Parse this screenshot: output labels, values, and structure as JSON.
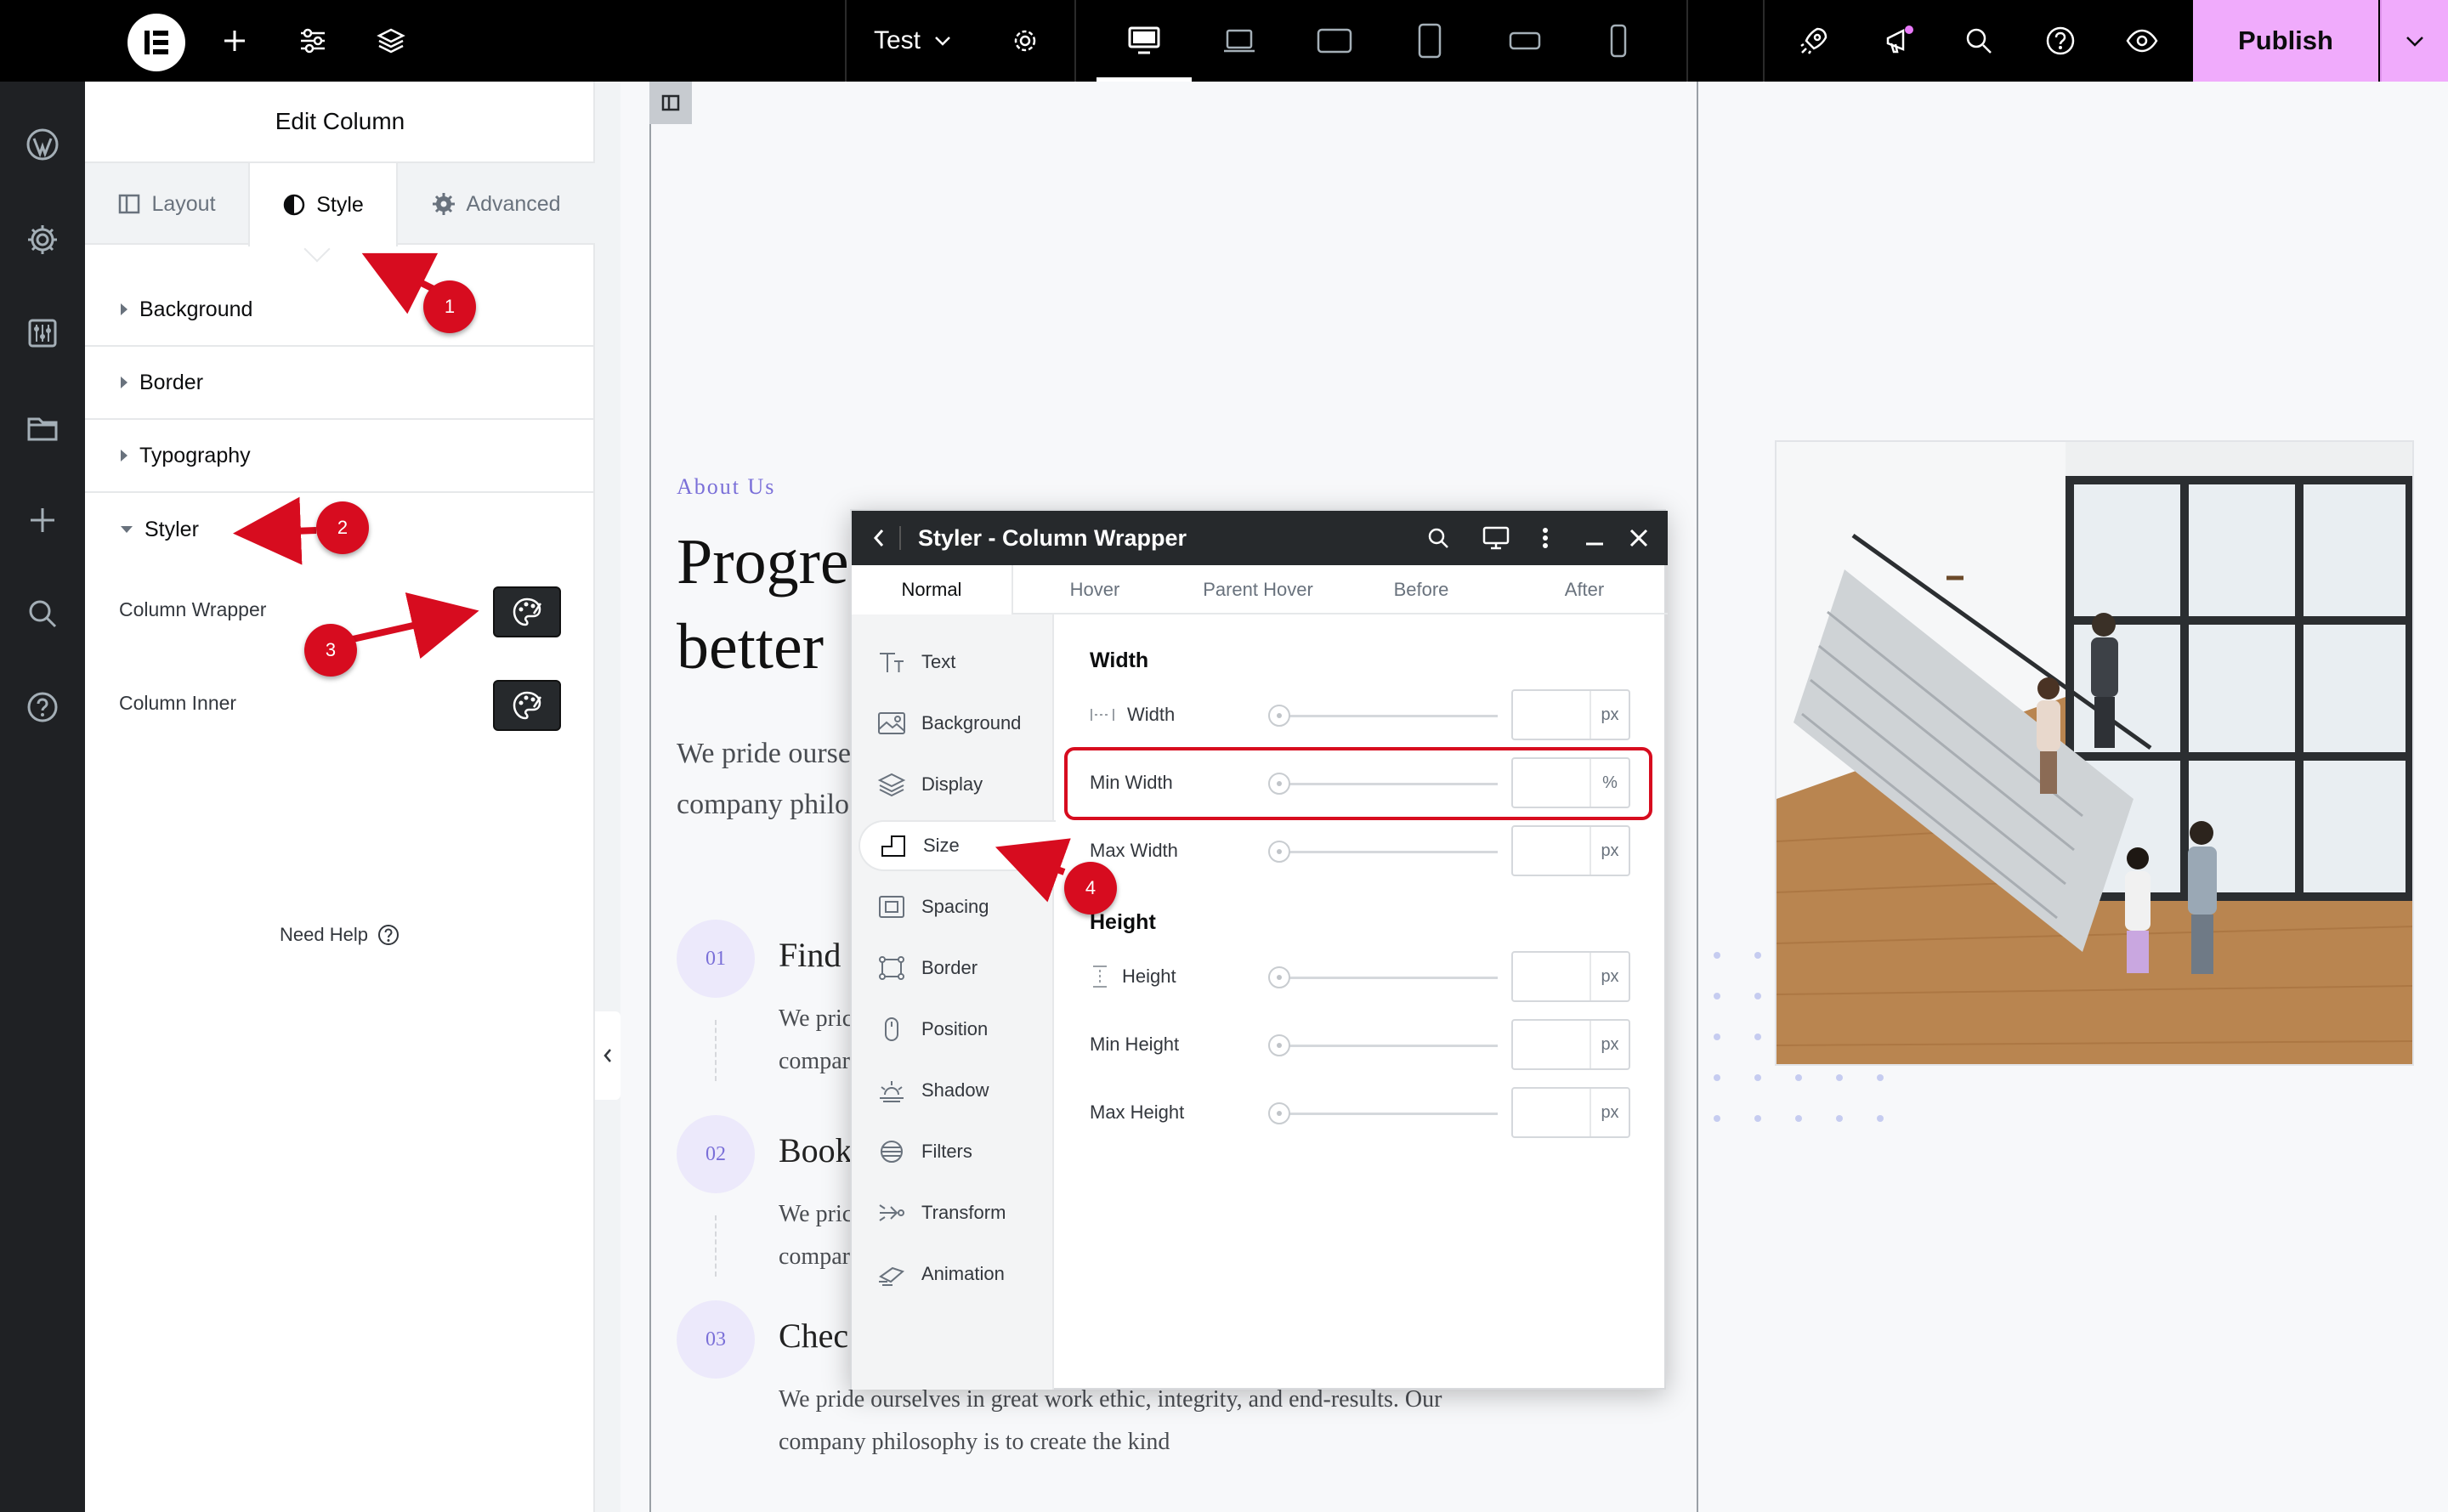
{
  "topbar": {
    "document_name": "Test",
    "publish_label": "Publish",
    "icons": [
      "add-element-icon",
      "site-settings-icon",
      "structure-layers-icon",
      "page-settings-gear-icon",
      "desktop-icon",
      "laptop-icon",
      "tablet-landscape-icon",
      "tablet-portrait-icon",
      "mobile-landscape-icon",
      "mobile-portrait-icon",
      "rocket-icon",
      "megaphone-icon",
      "search-icon",
      "help-icon",
      "preview-eye-icon",
      "chevron-down-icon"
    ],
    "notification_dot_color": "#e879f9",
    "publish_color": "#f0abfc"
  },
  "rail": {
    "icons": [
      "avatar",
      "wordpress-icon",
      "settings-gear-icon",
      "sliders-icon",
      "folder-icon",
      "add-icon",
      "search-icon",
      "help-icon"
    ]
  },
  "panel": {
    "title": "Edit Column",
    "tabs": [
      {
        "label": "Layout",
        "icon": "layout-icon"
      },
      {
        "label": "Style",
        "icon": "contrast-icon",
        "active": true
      },
      {
        "label": "Advanced",
        "icon": "gear-icon"
      }
    ],
    "sections": [
      {
        "label": "Background"
      },
      {
        "label": "Border"
      },
      {
        "label": "Typography"
      },
      {
        "label": "Styler",
        "open": true
      }
    ],
    "styler_rows": [
      {
        "label": "Column Wrapper",
        "icon": "palette-icon"
      },
      {
        "label": "Column Inner",
        "icon": "palette-icon"
      }
    ],
    "need_help": "Need Help"
  },
  "canvas": {
    "eyebrow": "About Us",
    "hero_line_1": "Progre",
    "hero_line_2": "better",
    "intro_line_1": "We pride ourse",
    "intro_line_2": "company philo",
    "steps": [
      {
        "num": "01",
        "title": "Find",
        "text_1": "We pric",
        "text_2": "compar"
      },
      {
        "num": "02",
        "title": "Book",
        "text_1": "We pric",
        "text_2": "compar"
      },
      {
        "num": "03",
        "title": "Chec",
        "text_1": "We pride ourselves in great work ethic, integrity, and end-results. Our",
        "text_2": "company philosophy is to create the kind"
      }
    ],
    "accent_color": "#7a6fd8"
  },
  "styler": {
    "title": "Styler - Column Wrapper",
    "tabs": [
      "Normal",
      "Hover",
      "Parent Hover",
      "Before",
      "After"
    ],
    "active_tab": "Normal",
    "side_items": [
      {
        "label": "Text",
        "icon": "text-icon"
      },
      {
        "label": "Background",
        "icon": "image-icon"
      },
      {
        "label": "Display",
        "icon": "layers-icon"
      },
      {
        "label": "Size",
        "icon": "size-icon",
        "active": true
      },
      {
        "label": "Spacing",
        "icon": "spacing-icon"
      },
      {
        "label": "Border",
        "icon": "border-icon"
      },
      {
        "label": "Position",
        "icon": "mouse-icon"
      },
      {
        "label": "Shadow",
        "icon": "sun-icon"
      },
      {
        "label": "Filters",
        "icon": "filters-icon"
      },
      {
        "label": "Transform",
        "icon": "transform-icon"
      },
      {
        "label": "Animation",
        "icon": "animation-icon"
      }
    ],
    "width_section": "Width",
    "height_section": "Height",
    "width_rows": [
      {
        "label": "Width",
        "unit": "px",
        "value": "",
        "icon": "width-icon"
      },
      {
        "label": "Min Width",
        "unit": "%",
        "value": ""
      },
      {
        "label": "Max Width",
        "unit": "px",
        "value": ""
      }
    ],
    "height_rows": [
      {
        "label": "Height",
        "unit": "px",
        "value": "",
        "icon": "height-icon"
      },
      {
        "label": "Min Height",
        "unit": "px",
        "value": ""
      },
      {
        "label": "Max Height",
        "unit": "px",
        "value": ""
      }
    ]
  },
  "annotations": {
    "badges": [
      "1",
      "2",
      "3",
      "4"
    ],
    "color": "#d70c1f"
  }
}
